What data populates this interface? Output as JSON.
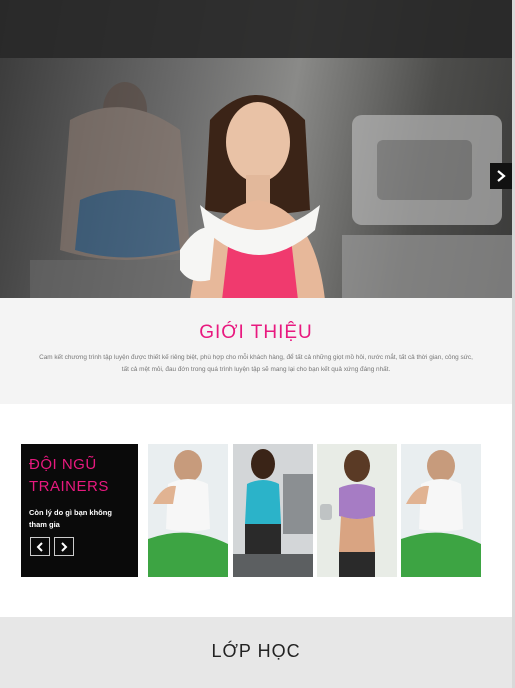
{
  "hero": {
    "next_icon": "chevron-right-icon"
  },
  "intro": {
    "title": "GIỚI THIỆU",
    "text": "Cam kết chương trình tập luyện được thiết kế riêng biệt, phù hợp cho mỗi khách hàng, để tất cả những giọt mồ hôi, nước mắt, tất cả thời gian, công sức, tất cả mệt mỏi, đau đớn trong quá trình luyện tập sẽ mang lại cho bạn kết quả xứng đáng nhất."
  },
  "trainers": {
    "title_line1": "ĐỘI NGŨ",
    "title_line2": "TRAINERS",
    "subtitle": "Còn lý do gì bạn không tham gia",
    "prev_icon": "chevron-left-icon",
    "next_icon": "chevron-right-icon"
  },
  "classes": {
    "title": "LỚP HỌC"
  },
  "colors": {
    "accent": "#e8197f",
    "dark": "#0a0a0a"
  }
}
